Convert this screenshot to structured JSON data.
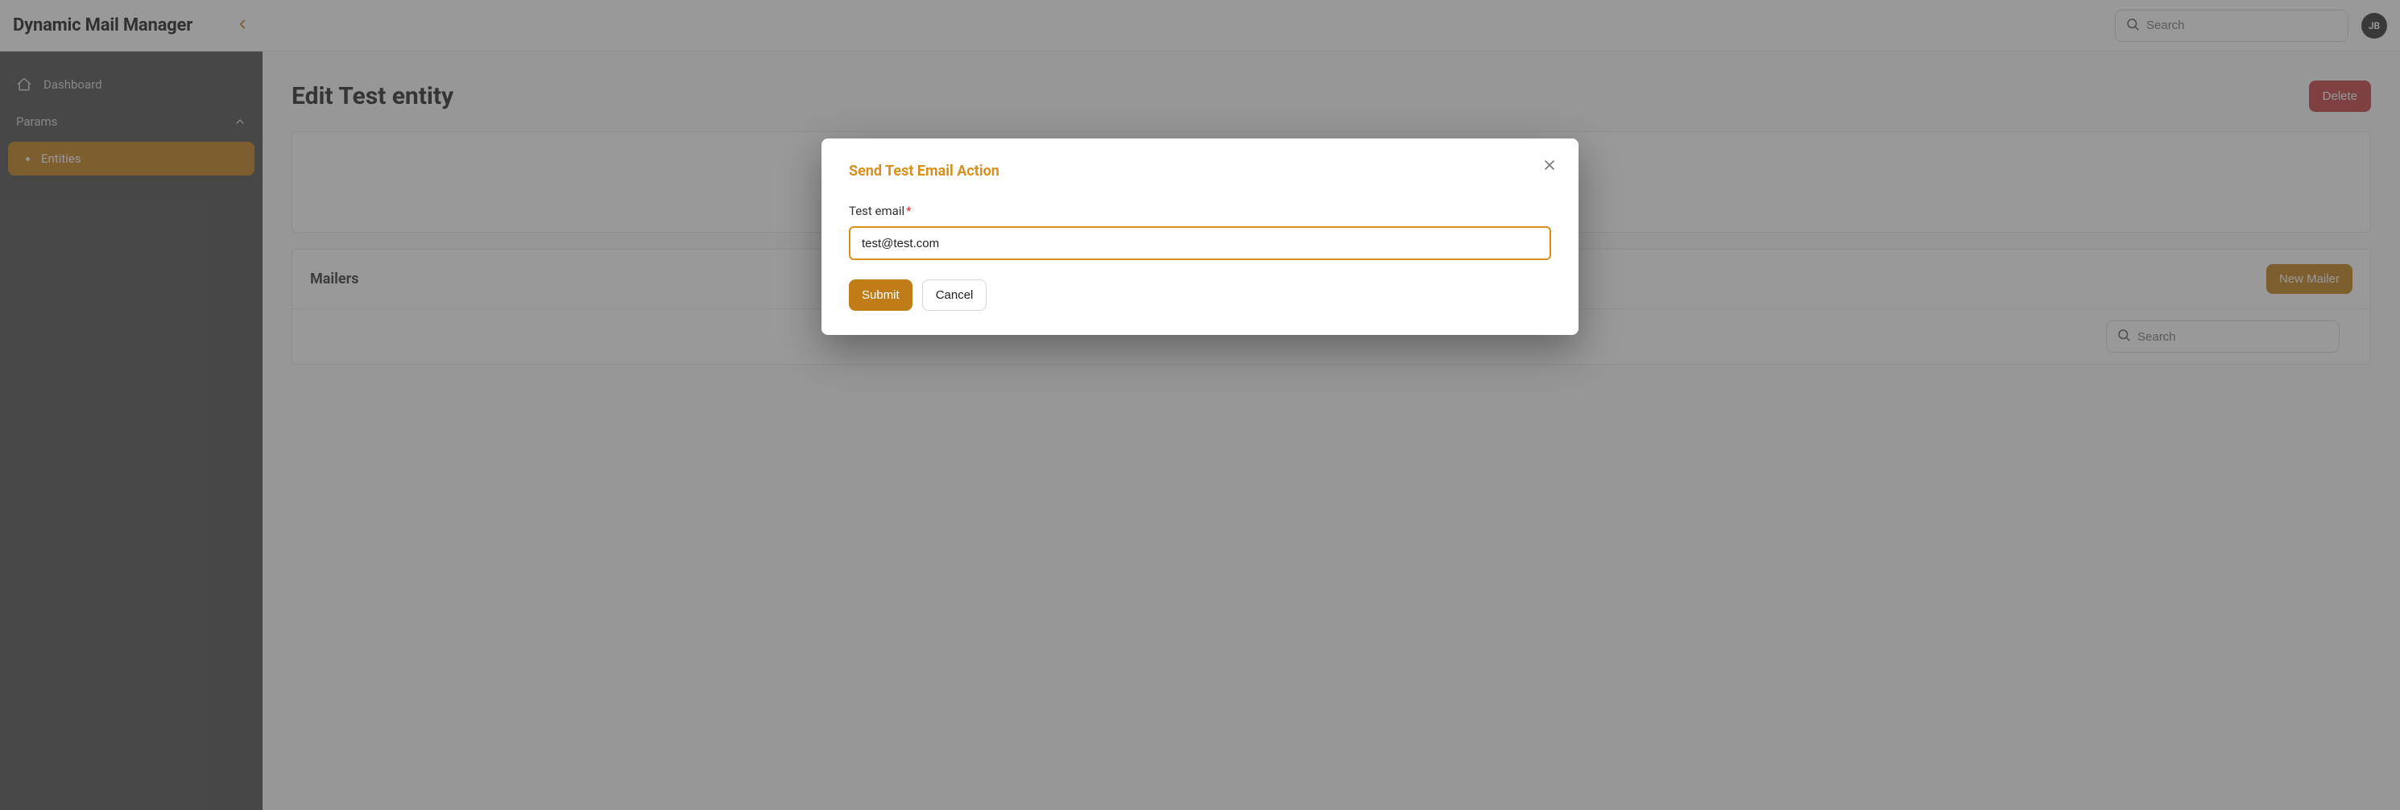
{
  "app": {
    "title": "Dynamic Mail Manager"
  },
  "search": {
    "placeholder": "Search"
  },
  "user": {
    "initials": "JB"
  },
  "sidebar": {
    "dashboard": "Dashboard",
    "params": "Params",
    "entities": "Entities"
  },
  "page": {
    "title": "Edit Test entity",
    "delete": "Delete"
  },
  "mailers": {
    "title": "Mailers",
    "new_button": "New Mailer",
    "search_placeholder": "Search"
  },
  "modal": {
    "title": "Send Test Email Action",
    "field_label": "Test email",
    "email_value": "test@test.com",
    "submit": "Submit",
    "cancel": "Cancel"
  }
}
